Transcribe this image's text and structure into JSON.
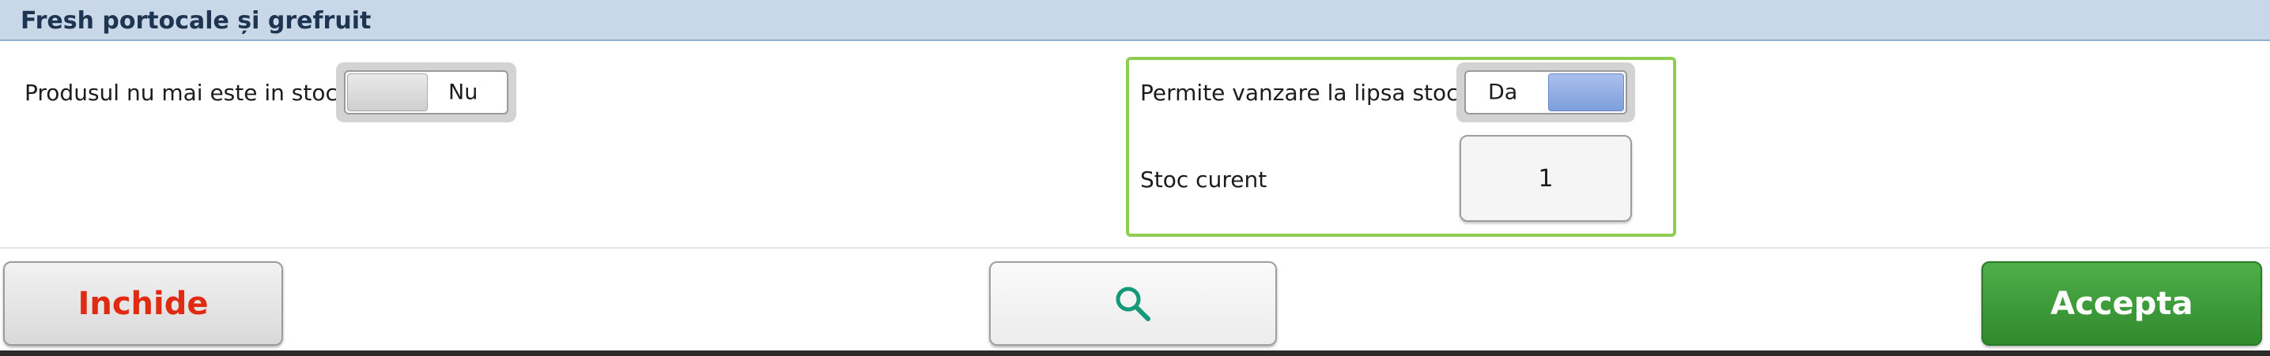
{
  "header": {
    "title": "Fresh portocale și grefruit"
  },
  "out_of_stock": {
    "label": "Produsul nu mai este in stoc",
    "toggle_value": "Nu",
    "checked": false
  },
  "allow_sale": {
    "label": "Permite vanzare la lipsa stoc",
    "toggle_value": "Da",
    "checked": true
  },
  "current_stock": {
    "label": "Stoc curent",
    "value": "1"
  },
  "buttons": {
    "close_label": "Inchide",
    "search_icon": "search-icon",
    "accept_label": "Accepta"
  },
  "colors": {
    "header_bg": "#c9d8e8",
    "header_text": "#1e3552",
    "close_text": "#e02a12",
    "accept_bg": "#3a9a36",
    "search_icon": "#16997a",
    "group_border": "#8fcc52",
    "toggle_on": "#7d9fdc"
  }
}
